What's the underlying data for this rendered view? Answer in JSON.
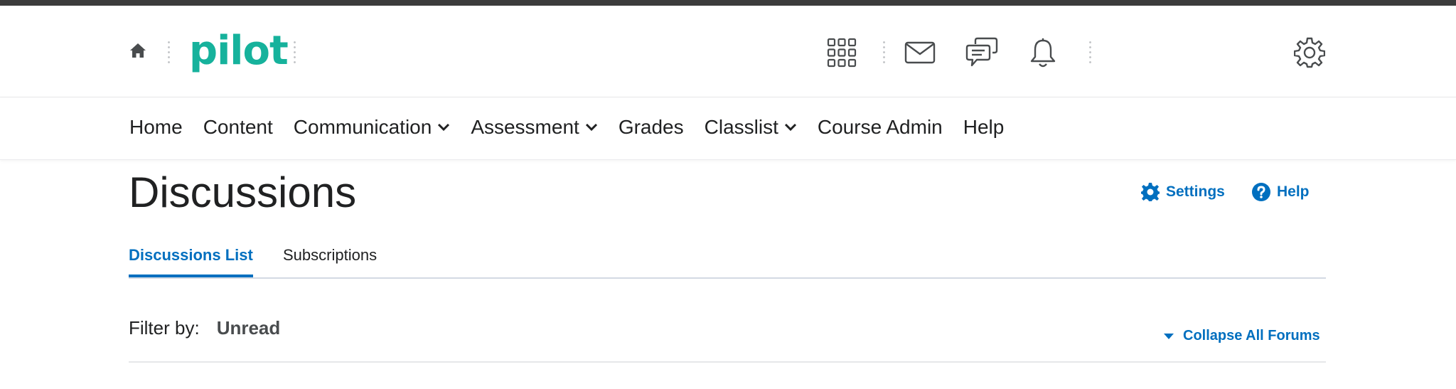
{
  "minibar": {
    "logo_text": "pilot",
    "icons": {
      "home": "home-icon",
      "course_selector": "grid-icon",
      "message_alerts": "envelope-icon",
      "subscription_alerts": "chat-bubbles-icon",
      "update_alerts": "bell-icon",
      "settings": "gear-icon"
    },
    "logo_color": "#16b29c"
  },
  "navbar": {
    "items": [
      {
        "label": "Home",
        "has_dropdown": false
      },
      {
        "label": "Content",
        "has_dropdown": false
      },
      {
        "label": "Communication",
        "has_dropdown": true
      },
      {
        "label": "Assessment",
        "has_dropdown": true
      },
      {
        "label": "Grades",
        "has_dropdown": false
      },
      {
        "label": "Classlist",
        "has_dropdown": true
      },
      {
        "label": "Course Admin",
        "has_dropdown": false
      },
      {
        "label": "Help",
        "has_dropdown": false
      }
    ]
  },
  "page": {
    "title": "Discussions",
    "settings_label": "Settings",
    "help_label": "Help",
    "tabs": [
      {
        "label": "Discussions List",
        "active": true
      },
      {
        "label": "Subscriptions",
        "active": false
      }
    ],
    "filter_label": "Filter by:",
    "filter_value": "Unread",
    "collapse_label": "Collapse All Forums"
  },
  "colors": {
    "accent": "#006fbf",
    "brand": "#16b29c",
    "text": "#202122"
  }
}
